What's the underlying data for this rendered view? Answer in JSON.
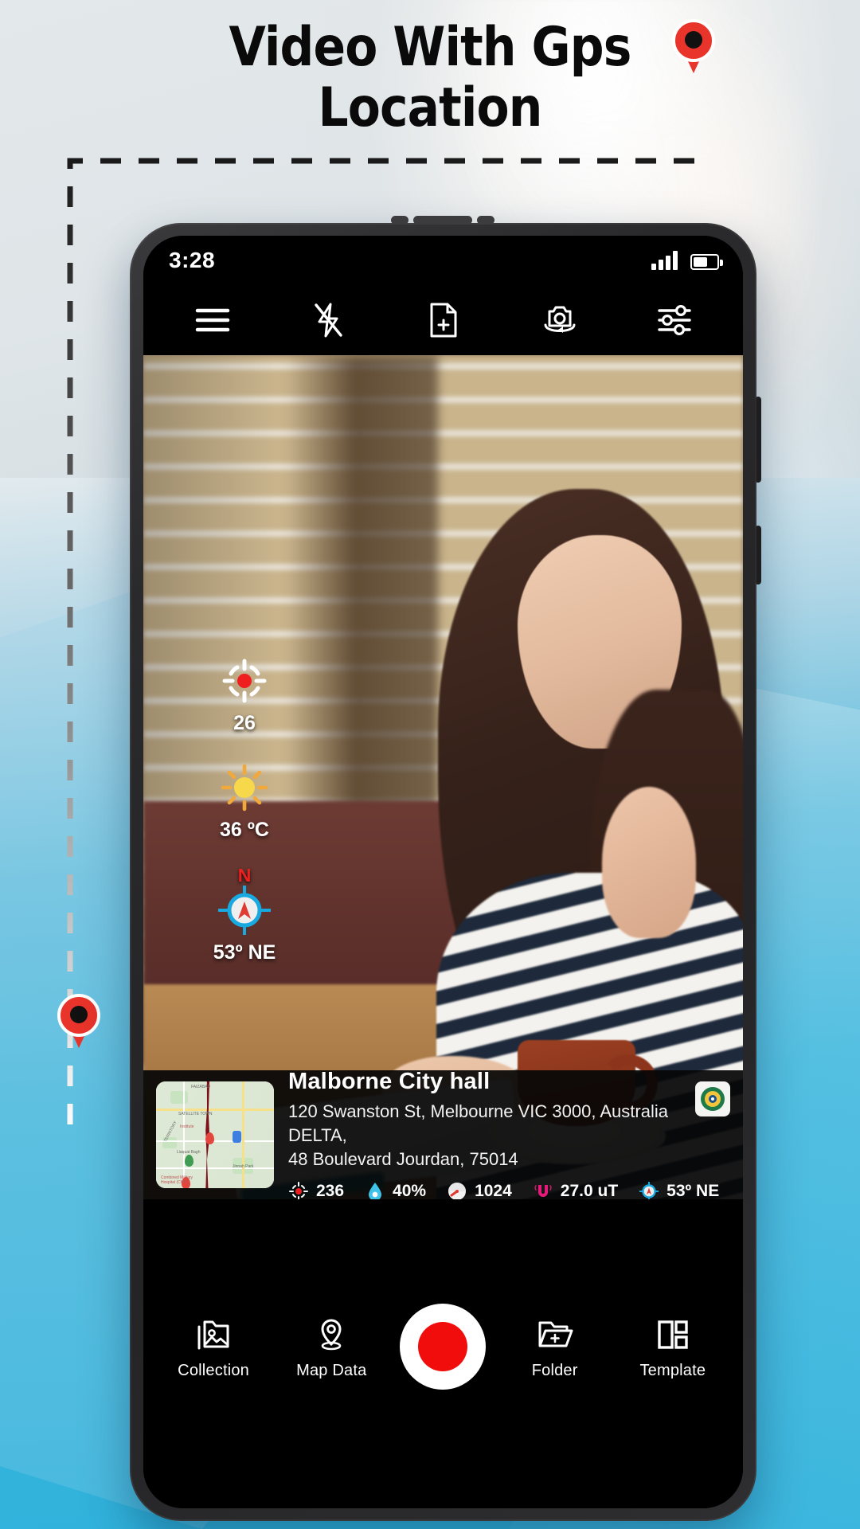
{
  "promo": {
    "headline_line1": "Video With Gps",
    "headline_line2": "Location"
  },
  "statusbar": {
    "time": "3:28",
    "signal_icon": "signal-bars-icon",
    "battery_icon": "battery-icon"
  },
  "toolbar": {
    "items": [
      {
        "name": "menu-icon",
        "label": "Menu"
      },
      {
        "name": "flash-off-icon",
        "label": "Flash Off"
      },
      {
        "name": "new-file-icon",
        "label": "New File"
      },
      {
        "name": "switch-camera-icon",
        "label": "Switch Camera"
      },
      {
        "name": "settings-sliders-icon",
        "label": "Settings"
      }
    ]
  },
  "overlay": {
    "altitude": {
      "icon": "target-crosshair-icon",
      "value": "26"
    },
    "temperature": {
      "icon": "sun-icon",
      "value": "36 ºC"
    },
    "compass": {
      "icon": "compass-icon",
      "north_label": "N",
      "value": "53º NE"
    }
  },
  "location_card": {
    "map_thumbnail": "map-thumbnail",
    "title": "Malborne City hall",
    "address_line1": "120 Swanston St, Melbourne VIC 3000, Australia DELTA,",
    "address_line2": "48 Boulevard Jourdan, 75014",
    "badge_icon": "app-logo-badge",
    "stats": [
      {
        "icon": "altitude-target-icon",
        "value": "236"
      },
      {
        "icon": "humidity-drop-icon",
        "value": "40%"
      },
      {
        "icon": "pressure-gauge-icon",
        "value": "1024"
      },
      {
        "icon": "magnet-icon",
        "value": "27.0 uT"
      },
      {
        "icon": "compass-icon",
        "value": "53º NE"
      }
    ]
  },
  "bottom_nav": {
    "items": [
      {
        "icon": "collection-photos-icon",
        "label": "Collection"
      },
      {
        "icon": "map-pin-icon",
        "label": "Map Data"
      },
      {
        "icon": "record-button-icon",
        "label": ""
      },
      {
        "icon": "folder-add-icon",
        "label": "Folder"
      },
      {
        "icon": "template-grid-icon",
        "label": "Template"
      }
    ],
    "record_label": "Record"
  },
  "decoration": {
    "pin_top": "map-pin-marker",
    "pin_bottom": "map-pin-marker",
    "accent_color": "#2FB2DC",
    "record_color": "#F20D0D"
  }
}
